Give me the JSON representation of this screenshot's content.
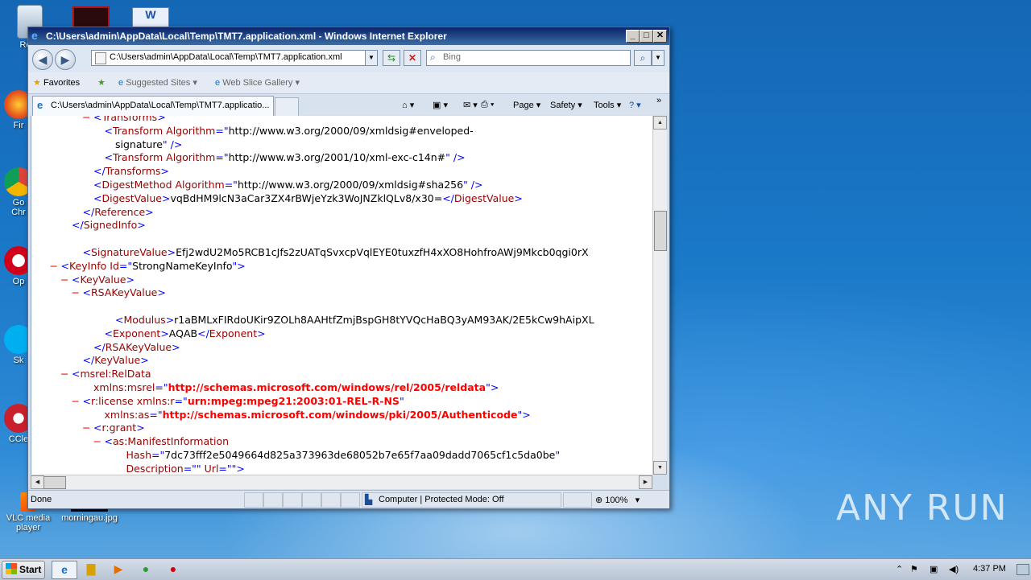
{
  "desktop": {
    "icons": [
      {
        "label": "Recy",
        "name": "recycle-bin"
      },
      {
        "label": "Fir",
        "name": "firefox"
      },
      {
        "label": "Go Chr",
        "name": "chrome"
      },
      {
        "label": "Op",
        "name": "opera"
      },
      {
        "label": "Sk",
        "name": "skype"
      },
      {
        "label": "CCle",
        "name": "ccleaner"
      },
      {
        "label": "VLC media player",
        "name": "vlc"
      },
      {
        "label": "morningau.jpg",
        "name": "image-file"
      }
    ],
    "watermark": "ANY RUN"
  },
  "window": {
    "title": "C:\\Users\\admin\\AppData\\Local\\Temp\\TMT7.application.xml - Windows Internet Explorer",
    "address": "C:\\Users\\admin\\AppData\\Local\\Temp\\TMT7.application.xml",
    "search_placeholder": "Bing",
    "favorites_label": "Favorites",
    "suggested_sites": "Suggested Sites",
    "web_slice_gallery": "Web Slice Gallery",
    "tab_title": "C:\\Users\\admin\\AppData\\Local\\Temp\\TMT7.applicatio...",
    "commands": {
      "page": "Page",
      "safety": "Safety",
      "tools": "Tools"
    },
    "status_text": "Done",
    "zone_text": "Computer | Protected Mode: Off",
    "zoom": "100%"
  },
  "xml_lines": [
    {
      "ind": 0,
      "minus": "−",
      "parts": [
        [
          "bk",
          "<"
        ],
        [
          "tg",
          "Transforms"
        ],
        [
          "bk",
          ">"
        ]
      ]
    },
    {
      "ind": 1,
      "parts": [
        [
          "bk",
          "<"
        ],
        [
          "tg",
          "Transform "
        ],
        [
          "at",
          "Algorithm"
        ],
        [
          "bk",
          "=\""
        ],
        [
          "av",
          "http://www.w3.org/2000/09/xmldsig#enveloped-"
        ]
      ]
    },
    {
      "ind": 2,
      "parts": [
        [
          "av",
          "signature"
        ],
        [
          "bk",
          "\" />"
        ]
      ]
    },
    {
      "ind": 1,
      "parts": [
        [
          "bk",
          "<"
        ],
        [
          "tg",
          "Transform "
        ],
        [
          "at",
          "Algorithm"
        ],
        [
          "bk",
          "=\""
        ],
        [
          "av",
          "http://www.w3.org/2001/10/xml-exc-c14n#"
        ],
        [
          "bk",
          "\" />"
        ]
      ]
    },
    {
      "ind": 0,
      "parts": [
        [
          "bk",
          "</"
        ],
        [
          "tg",
          "Transforms"
        ],
        [
          "bk",
          ">"
        ]
      ]
    },
    {
      "ind": 0,
      "parts": [
        [
          "bk",
          "<"
        ],
        [
          "tg",
          "DigestMethod "
        ],
        [
          "at",
          "Algorithm"
        ],
        [
          "bk",
          "=\""
        ],
        [
          "av",
          "http://www.w3.org/2000/09/xmldsig#sha256"
        ],
        [
          "bk",
          "\" />"
        ]
      ]
    },
    {
      "ind": 0,
      "parts": [
        [
          "bk",
          "<"
        ],
        [
          "tg",
          "DigestValue"
        ],
        [
          "bk",
          ">"
        ],
        [
          "tx",
          "vqBdHM9lcN3aCar3ZX4rBWjeYzk3WoJNZklQLv8/x30="
        ],
        [
          "bk",
          "</"
        ],
        [
          "tg",
          "DigestValue"
        ],
        [
          "bk",
          ">"
        ]
      ]
    },
    {
      "ind": -1,
      "parts": [
        [
          "bk",
          "</"
        ],
        [
          "tg",
          "Reference"
        ],
        [
          "bk",
          ">"
        ]
      ]
    },
    {
      "ind": -2,
      "parts": [
        [
          "bk",
          "</"
        ],
        [
          "tg",
          "SignedInfo"
        ],
        [
          "bk",
          ">"
        ]
      ]
    },
    {
      "ind": -1,
      "parts": []
    },
    {
      "ind": -1,
      "parts": [
        [
          "bk",
          "<"
        ],
        [
          "tg",
          "SignatureValue"
        ],
        [
          "bk",
          ">"
        ],
        [
          "tx",
          "Efj2wdU2Mo5RCB1cJfs2zUATqSvxcpVqlEYE0tuxzfH4xXO8HohfroAWj9Mkcb0qgi0rX"
        ]
      ]
    },
    {
      "ind": -3,
      "minus": "−",
      "parts": [
        [
          "bk",
          "<"
        ],
        [
          "tg",
          "KeyInfo "
        ],
        [
          "at",
          "Id"
        ],
        [
          "bk",
          "=\""
        ],
        [
          "av",
          "StrongNameKeyInfo"
        ],
        [
          "bk",
          "\">"
        ]
      ]
    },
    {
      "ind": -2,
      "minus": "−",
      "parts": [
        [
          "bk",
          "<"
        ],
        [
          "tg",
          "KeyValue"
        ],
        [
          "bk",
          ">"
        ]
      ]
    },
    {
      "ind": -1,
      "minus": "−",
      "parts": [
        [
          "bk",
          "<"
        ],
        [
          "tg",
          "RSAKeyValue"
        ],
        [
          "bk",
          ">"
        ]
      ]
    },
    {
      "ind": 0,
      "parts": []
    },
    {
      "ind": 2,
      "parts": [
        [
          "bk",
          "<"
        ],
        [
          "tg",
          "Modulus"
        ],
        [
          "bk",
          ">"
        ],
        [
          "tx",
          "r1aBMLxFIRdoUKir9ZOLh8AAHtfZmjBspGH8tYVQcHaBQ3yAM93AK/2E5kCw9hAipXL"
        ]
      ]
    },
    {
      "ind": 1,
      "parts": [
        [
          "bk",
          "<"
        ],
        [
          "tg",
          "Exponent"
        ],
        [
          "bk",
          ">"
        ],
        [
          "tx",
          "AQAB"
        ],
        [
          "bk",
          "</"
        ],
        [
          "tg",
          "Exponent"
        ],
        [
          "bk",
          ">"
        ]
      ]
    },
    {
      "ind": 0,
      "parts": [
        [
          "bk",
          "</"
        ],
        [
          "tg",
          "RSAKeyValue"
        ],
        [
          "bk",
          ">"
        ]
      ]
    },
    {
      "ind": -1,
      "parts": [
        [
          "bk",
          "</"
        ],
        [
          "tg",
          "KeyValue"
        ],
        [
          "bk",
          ">"
        ]
      ]
    },
    {
      "ind": -2,
      "minus": "−",
      "parts": [
        [
          "bk",
          "<"
        ],
        [
          "tg",
          "msrel:RelData"
        ]
      ]
    },
    {
      "ind": 0,
      "parts": [
        [
          "at",
          "xmlns:msrel"
        ],
        [
          "bk",
          "=\""
        ],
        [
          "ns",
          "http://schemas.microsoft.com/windows/rel/2005/reldata"
        ],
        [
          "bk",
          "\">"
        ]
      ]
    },
    {
      "ind": -1,
      "minus": "−",
      "parts": [
        [
          "bk",
          "<"
        ],
        [
          "tg",
          "r:license "
        ],
        [
          "at",
          "xmlns:r"
        ],
        [
          "bk",
          "=\""
        ],
        [
          "ns",
          "urn:mpeg:mpeg21:2003:01-REL-R-NS"
        ],
        [
          "bk",
          "\""
        ]
      ]
    },
    {
      "ind": 1,
      "parts": [
        [
          "at",
          "xmlns:as"
        ],
        [
          "bk",
          "=\""
        ],
        [
          "ns",
          "http://schemas.microsoft.com/windows/pki/2005/Authenticode"
        ],
        [
          "bk",
          "\">"
        ]
      ]
    },
    {
      "ind": 0,
      "minus": "−",
      "parts": [
        [
          "bk",
          "<"
        ],
        [
          "tg",
          "r:grant"
        ],
        [
          "bk",
          ">"
        ]
      ]
    },
    {
      "ind": 1,
      "minus": "−",
      "parts": [
        [
          "bk",
          "<"
        ],
        [
          "tg",
          "as:ManifestInformation"
        ]
      ]
    },
    {
      "ind": 3,
      "parts": [
        [
          "at",
          "Hash"
        ],
        [
          "bk",
          "=\""
        ],
        [
          "av",
          "7dc73fff2e5049664d825a373963de68052b7e65f7aa09dadd7065cf1c5da0be"
        ],
        [
          "bk",
          "\""
        ]
      ]
    },
    {
      "ind": 3,
      "parts": [
        [
          "at",
          "Description"
        ],
        [
          "bk",
          "=\"\" "
        ],
        [
          "at",
          "Url"
        ],
        [
          "bk",
          "=\"\">"
        ]
      ]
    }
  ],
  "taskbar": {
    "start_label": "Start",
    "clock": "4:37 PM"
  }
}
